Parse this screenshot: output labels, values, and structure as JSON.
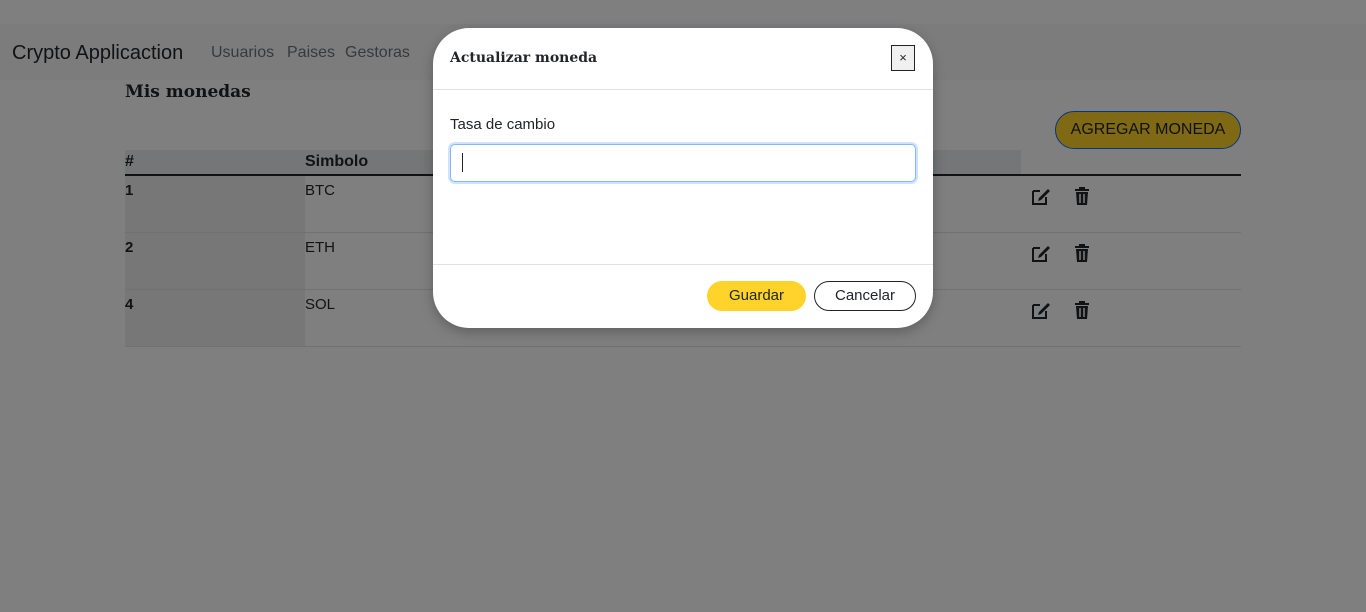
{
  "navbar": {
    "brand": "Crypto Applicaction",
    "links": [
      "Usuarios",
      "Paises",
      "Gestoras"
    ]
  },
  "page": {
    "title": "Mis monedas",
    "add_button": "AGREGAR MONEDA"
  },
  "table": {
    "headers": [
      "#",
      "Simbolo"
    ],
    "rows": [
      {
        "id": "1",
        "symbol": "BTC"
      },
      {
        "id": "2",
        "symbol": "ETH"
      },
      {
        "id": "4",
        "symbol": "SOL"
      }
    ],
    "row_actions": [
      "edit-icon",
      "trash-icon"
    ]
  },
  "modal": {
    "title": "Actualizar moneda",
    "close_label": "×",
    "field_label": "Tasa de cambio",
    "field_value": "",
    "save_label": "Guardar",
    "cancel_label": "Cancelar"
  },
  "colors": {
    "accent": "#ffd32a",
    "focus": "#86b7fe"
  }
}
